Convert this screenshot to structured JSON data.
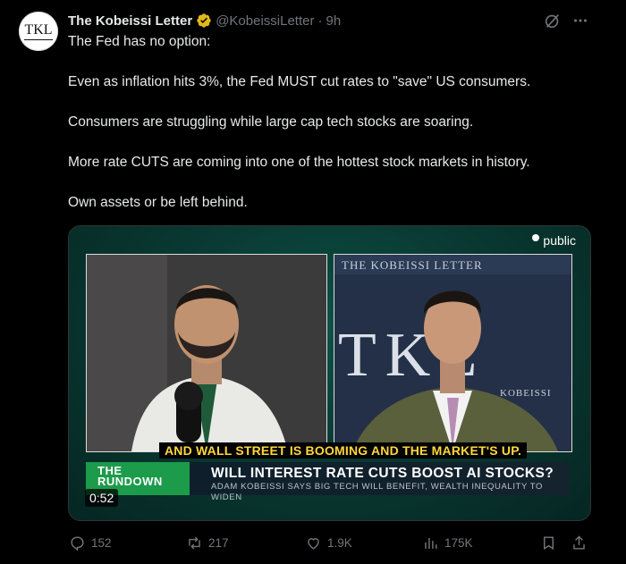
{
  "author": {
    "avatar_text": "TKL",
    "name": "The Kobeissi Letter",
    "handle": "@KobeissiLetter",
    "separator": "·",
    "time": "9h"
  },
  "post": {
    "paragraphs": [
      "The Fed has no option:",
      "Even as inflation hits 3%, the Fed MUST cut rates to \"save\" US consumers.",
      "Consumers are struggling while large cap tech stocks are soaring.",
      "More rate CUTS are coming into one of the hottest stock markets in history.",
      "Own assets or be left behind."
    ]
  },
  "media": {
    "brand": "public",
    "backdrop_banner": "THE KOBEISSI LETTER",
    "backdrop_letters": "TKL",
    "backdrop_lower": "KOBEISSI",
    "caption": "AND WALL STREET IS BOOMING AND THE MARKET'S UP.",
    "show_line1": "THE",
    "show_line2": "RUNDOWN",
    "headline": "WILL INTEREST RATE CUTS BOOST AI STOCKS?",
    "subline": "ADAM KOBEISSI SAYS BIG TECH WILL BENEFIT, WEALTH INEQUALITY TO WIDEN",
    "timecode": "0:52"
  },
  "actions": {
    "replies": "152",
    "reposts": "217",
    "likes": "1.9K",
    "views": "175K"
  },
  "icons": {
    "verified": "verified-badge-icon",
    "grok": "grok-icon",
    "more": "more-icon",
    "reply": "reply-icon",
    "repost": "repost-icon",
    "like": "like-icon",
    "views": "views-icon",
    "bookmark": "bookmark-icon",
    "share": "share-icon"
  },
  "colors": {
    "background": "#000000",
    "text": "#e7e9ea",
    "muted": "#71767b",
    "verified_gold": "#e2b719",
    "caption_yellow": "#ffd83a",
    "rundown_green": "#1c9b4b"
  }
}
